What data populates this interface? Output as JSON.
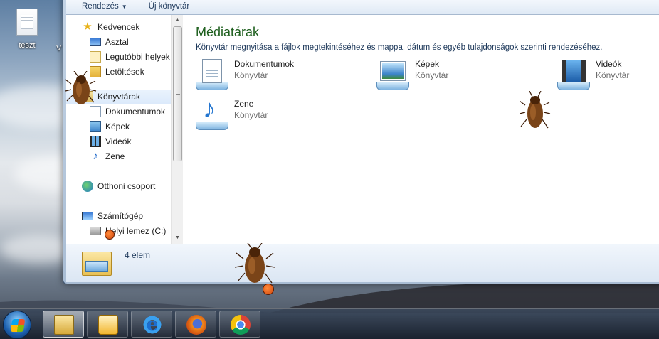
{
  "desktop": {
    "icons": [
      {
        "label": "teszt"
      }
    ],
    "partial_label": "V"
  },
  "window": {
    "toolbar": {
      "organize_label": "Rendezés",
      "new_library_label": "Új könyvtár"
    },
    "nav": {
      "items": [
        {
          "label": "Kedvencek",
          "icon": "star-icon"
        },
        {
          "label": "Asztal",
          "icon": "desktop-icon"
        },
        {
          "label": "Legutóbbi helyek",
          "icon": "recent-places-icon"
        },
        {
          "label": "Letöltések",
          "icon": "downloads-icon"
        },
        {
          "label": "Könyvtárak",
          "icon": "libraries-icon"
        },
        {
          "label": "Dokumentumok",
          "icon": "documents-icon"
        },
        {
          "label": "Képek",
          "icon": "pictures-icon"
        },
        {
          "label": "Videók",
          "icon": "videos-icon"
        },
        {
          "label": "Zene",
          "icon": "music-icon"
        },
        {
          "label": "Otthoni csoport",
          "icon": "homegroup-icon"
        },
        {
          "label": "Számítógép",
          "icon": "computer-icon"
        },
        {
          "label": "Helyi lemez (C:)",
          "icon": "drive-icon"
        }
      ]
    },
    "main": {
      "title": "Médiatárak",
      "subtitle": "Könyvtár megnyitása a fájlok megtekintéséhez és mappa, dátum és egyéb tulajdonságok szerinti rendezéséhez.",
      "libraries": [
        {
          "name": "Dokumentumok",
          "kind": "Könyvtár",
          "icon": "documents-library-icon"
        },
        {
          "name": "Képek",
          "kind": "Könyvtár",
          "icon": "pictures-library-icon"
        },
        {
          "name": "Videók",
          "kind": "Könyvtár",
          "icon": "videos-library-icon"
        },
        {
          "name": "Zene",
          "kind": "Könyvtár",
          "icon": "music-library-icon"
        }
      ]
    },
    "status": {
      "count_text": "4 elem"
    }
  },
  "taskbar": {
    "items": [
      {
        "icon": "start-orb-icon"
      },
      {
        "icon": "explorer-icon",
        "active": true
      },
      {
        "icon": "media-player-icon"
      },
      {
        "icon": "internet-explorer-icon"
      },
      {
        "icon": "firefox-icon"
      },
      {
        "icon": "chrome-icon"
      }
    ]
  },
  "colors": {
    "title_green": "#1e5f1e",
    "link_blue": "#1e395b"
  }
}
